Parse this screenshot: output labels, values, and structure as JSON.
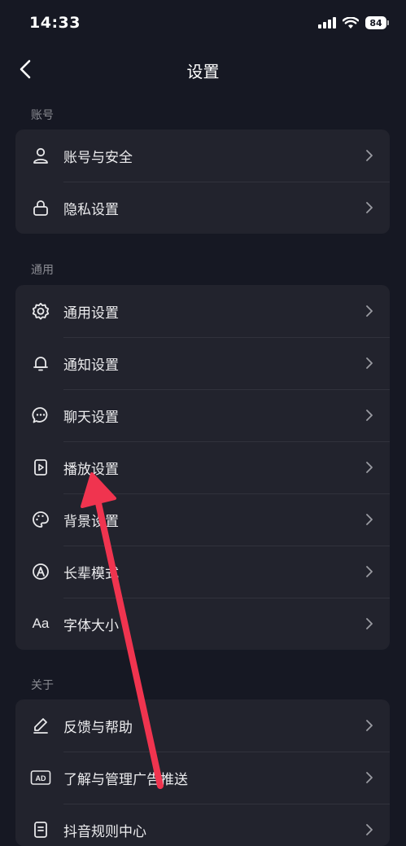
{
  "status_bar": {
    "time": "14:33",
    "battery": "84"
  },
  "header": {
    "title": "设置"
  },
  "sections": [
    {
      "title": "账号",
      "items": [
        {
          "label": "账号与安全",
          "icon": "user-icon"
        },
        {
          "label": "隐私设置",
          "icon": "lock-icon"
        }
      ]
    },
    {
      "title": "通用",
      "items": [
        {
          "label": "通用设置",
          "icon": "gear-icon"
        },
        {
          "label": "通知设置",
          "icon": "bell-icon"
        },
        {
          "label": "聊天设置",
          "icon": "chat-bubble-icon"
        },
        {
          "label": "播放设置",
          "icon": "play-file-icon"
        },
        {
          "label": "背景设置",
          "icon": "palette-icon"
        },
        {
          "label": "长辈模式",
          "icon": "elder-mode-icon"
        },
        {
          "label": "字体大小",
          "icon": "font-size-icon",
          "icon_text": "Aa"
        }
      ]
    },
    {
      "title": "关于",
      "items": [
        {
          "label": "反馈与帮助",
          "icon": "pencil-icon"
        },
        {
          "label": "了解与管理广告推送",
          "icon": "ad-icon",
          "icon_text": "AD"
        },
        {
          "label": "抖音规则中心",
          "icon": "rules-doc-icon"
        }
      ]
    }
  ],
  "colors": {
    "background": "#161823",
    "card": "#22232d",
    "annotation_arrow": "#f0344f"
  }
}
